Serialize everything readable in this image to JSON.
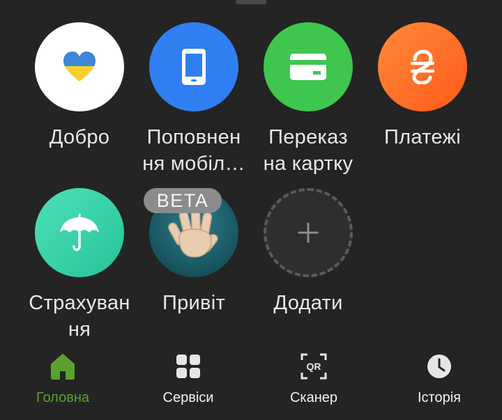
{
  "colors": {
    "background": "#242424",
    "accent_active": "#5aa12f",
    "text": "#e8e8e8"
  },
  "tiles": [
    {
      "label_lines": [
        "Добро",
        ""
      ],
      "icon": "ukraine-heart-icon",
      "color": "#ffffff"
    },
    {
      "label_lines": [
        "Поповнен",
        "ня мобіл…"
      ],
      "icon": "phone-icon",
      "color": "#2f7ff2"
    },
    {
      "label_lines": [
        "Переказ",
        "на картку"
      ],
      "icon": "card-icon",
      "color": "#3fc64f"
    },
    {
      "label_lines": [
        "Платежі",
        ""
      ],
      "icon": "hryvnia-icon",
      "color": "#ff6a22"
    },
    {
      "label_lines": [
        "Страхуван",
        "ня"
      ],
      "icon": "umbrella-icon",
      "color": "#35d1a6"
    },
    {
      "label_lines": [
        "Привіт",
        ""
      ],
      "icon": "waving-hand-icon",
      "color": "#1e5f6b",
      "badge": "BETA"
    },
    {
      "label_lines": [
        "Додати",
        ""
      ],
      "icon": "plus-icon",
      "color": "#2e2e2e"
    }
  ],
  "nav": {
    "items": [
      {
        "label": "Головна",
        "icon": "home-icon",
        "active": true
      },
      {
        "label": "Сервіси",
        "icon": "grid-icon",
        "active": false
      },
      {
        "label": "Сканер",
        "icon": "qr-scanner-icon",
        "active": false,
        "icon_text": "QR"
      },
      {
        "label": "Історія",
        "icon": "clock-icon",
        "active": false
      }
    ]
  }
}
